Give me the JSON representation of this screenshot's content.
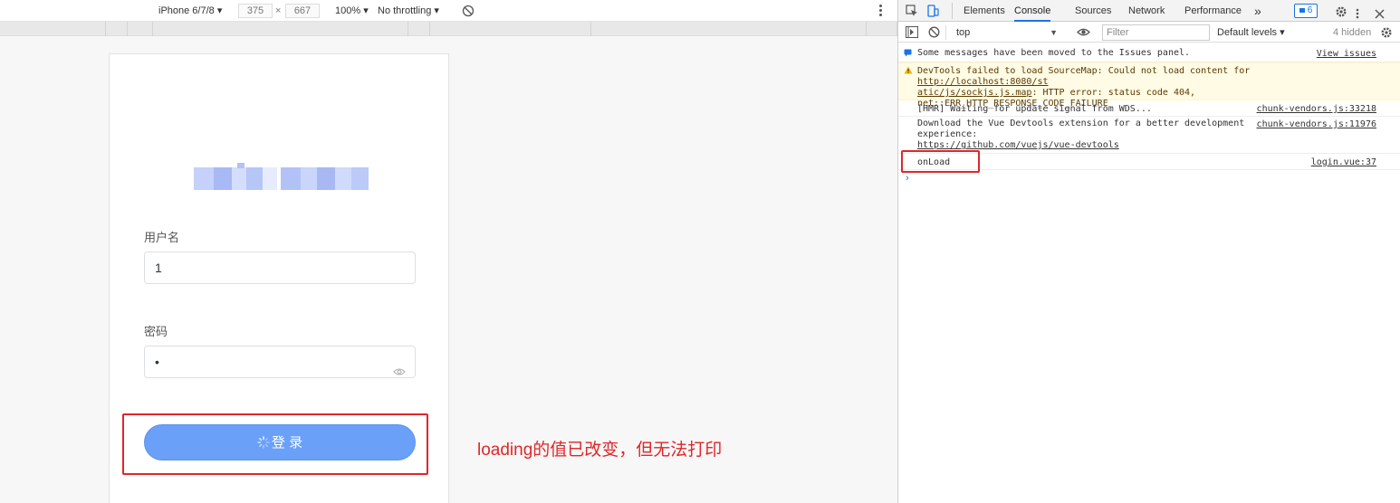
{
  "emulation": {
    "device": "iPhone 6/7/8 ▾",
    "width": "375",
    "height": "667",
    "times": "×",
    "zoom": "100% ▾",
    "throttle": "No throttling ▾"
  },
  "login": {
    "username_label": "用户名",
    "username_value": "1",
    "password_label": "密码",
    "password_value": "•",
    "login_button": "登 录"
  },
  "annotation": "loading的值已改变，但无法打印",
  "devtools": {
    "tabs": [
      "Elements",
      "Console",
      "Sources",
      "Network",
      "Performance"
    ],
    "more": "»",
    "issues_count": "6",
    "context": "top",
    "filter_placeholder": "Filter",
    "levels": "Default levels ▾",
    "hidden": "4 hidden",
    "messages": [
      {
        "text": "Some messages have been moved to the Issues panel.",
        "source": "View issues"
      },
      {
        "text_line1": "DevTools failed to load SourceMap: Could not load content for ",
        "link_part1": "http://localhost:8080/st",
        "link_part2": "atic/js/sockjs.js.map",
        "text_line2_rest": ": HTTP error: status code 404,",
        "text_line3": "net::ERR_HTTP_RESPONSE_CODE_FAILURE"
      },
      {
        "text": "[HMR] Waiting for update signal from WDS...",
        "source": "chunk-vendors.js:33218"
      },
      {
        "text_line1": "Download the Vue Devtools extension for a better development",
        "text_line2": "experience:",
        "text_line3": "https://github.com/vuejs/vue-devtools",
        "source": "chunk-vendors.js:11976"
      },
      {
        "text": "onLoad",
        "source": "login.vue:37"
      }
    ],
    "prompt": "›"
  },
  "colors": {
    "accent": "#1a73e8",
    "button": "#6aa0f8",
    "highlight": "#e0262a"
  }
}
